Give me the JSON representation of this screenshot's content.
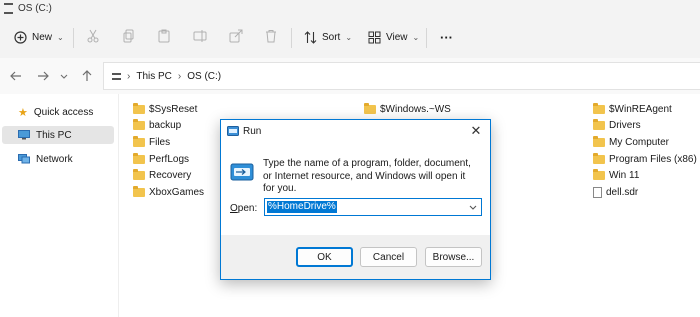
{
  "window": {
    "title": "OS (C:)"
  },
  "toolbar": {
    "new_label": "New",
    "sort_label": "Sort",
    "view_label": "View",
    "more_label": "···"
  },
  "address": {
    "segments": [
      "This PC",
      "OS (C:)"
    ]
  },
  "sidebar": {
    "items": [
      {
        "label": "Quick access",
        "icon": "star-icon"
      },
      {
        "label": "This PC",
        "icon": "computer-icon",
        "active": true
      },
      {
        "label": "Network",
        "icon": "network-icon"
      }
    ]
  },
  "files": {
    "col1": [
      "$SysReset",
      "backup",
      "Files",
      "PerfLogs",
      "Recovery",
      "XboxGames"
    ],
    "col2": [
      "$Windows.~WS"
    ],
    "col3": [
      "$WinREAgent",
      "Drivers",
      "My Computer",
      "Program Files (x86)",
      "Win 11",
      "dell.sdr"
    ]
  },
  "run_dialog": {
    "title": "Run",
    "description": "Type the name of a program, folder, document, or Internet resource, and Windows will open it for you.",
    "open_label_underlined": "O",
    "open_label_rest": "pen:",
    "open_value": "%HomeDrive%",
    "ok_label": "OK",
    "cancel_label": "Cancel",
    "browse_label": "Browse..."
  },
  "colors": {
    "accent": "#0078d4",
    "folder": "#f2c44d",
    "chrome": "#f3f3f3"
  }
}
